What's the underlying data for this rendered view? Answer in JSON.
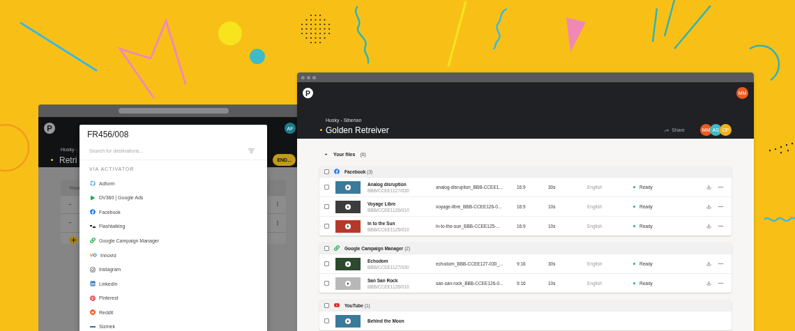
{
  "back_window": {
    "logo": "P",
    "avatar": "AF",
    "breadcrumb": "Husky -",
    "title": "Retri",
    "send_button": "END...",
    "card_title": "Your"
  },
  "modal": {
    "title": "FR456/008",
    "search": {
      "placeholder": "Search for destinations..."
    },
    "section_label": "VIA ACTIVATOR",
    "destinations": [
      {
        "name": "Adform",
        "kind": "adform"
      },
      {
        "name": "DV360 | Google Ads",
        "kind": "dv360"
      },
      {
        "name": "Facebook",
        "kind": "facebook"
      },
      {
        "name": "Flashtalking",
        "kind": "flashtalking"
      },
      {
        "name": "Google Campaign Manager",
        "kind": "gcm"
      },
      {
        "name": "Innovid",
        "kind": "innovid"
      },
      {
        "name": "Instagram",
        "kind": "instagram"
      },
      {
        "name": "LinkedIn",
        "kind": "linkedin"
      },
      {
        "name": "Pinterest",
        "kind": "pinterest"
      },
      {
        "name": "Reddit",
        "kind": "reddit"
      },
      {
        "name": "Sizmek",
        "kind": "sizmek"
      }
    ]
  },
  "front_window": {
    "logo": "P",
    "user_avatar": "MM",
    "breadcrumb": "Husky - Siberian",
    "title": "Golden Retreiver",
    "share": "Share",
    "collaborators": [
      {
        "initials": "MM",
        "color": "#ef5a1e"
      },
      {
        "initials": "AS",
        "color": "#3fbac6"
      },
      {
        "initials": "CP",
        "color": "#f5b21a"
      }
    ],
    "files_heading": "Your files",
    "files_count": "(6)",
    "expanded": true,
    "groups": [
      {
        "name": "Facebook",
        "count": "(3)",
        "kind": "facebook",
        "checked": false,
        "files": [
          {
            "title": "Analog disruption",
            "code": "BBB/CCEE1127/030",
            "filename": "analog-disruption_BBB-CCEE1...",
            "ratio": "16:9",
            "duration": "30s",
            "language": "English",
            "status": "Ready",
            "checked": false
          },
          {
            "title": "Voyage Libre",
            "code": "BBB/CCEE1126/010",
            "filename": "voyage-libre_BBB-CCEE126-0...",
            "ratio": "16:9",
            "duration": "10s",
            "language": "English",
            "status": "Ready",
            "checked": false
          },
          {
            "title": "In to the Sun",
            "code": "BBB/CCEE1125/010",
            "filename": "in-to-the-sun_BBB-CCEE125-...",
            "ratio": "16:9",
            "duration": "10s",
            "language": "English",
            "status": "Ready",
            "checked": false
          }
        ]
      },
      {
        "name": "Google Campaign Manager",
        "count": "(2)",
        "kind": "gcm",
        "checked": false,
        "files": [
          {
            "title": "Echodom",
            "code": "BBB/CCEE1127/030",
            "filename": "echodom_BBB-CCEE127-030_...",
            "ratio": "9:16",
            "duration": "30s",
            "language": "English",
            "status": "Ready",
            "checked": false
          },
          {
            "title": "San San Rock",
            "code": "BBB/CCEE1126/010",
            "filename": "san-san-rock_BBB-CCEE126-0...",
            "ratio": "9:16",
            "duration": "10s",
            "language": "English",
            "status": "Ready",
            "checked": false
          }
        ]
      },
      {
        "name": "YouTube",
        "count": "(1)",
        "kind": "youtube",
        "checked": false,
        "files": [
          {
            "title": "Behind the Moon",
            "checked": false
          }
        ]
      }
    ]
  }
}
